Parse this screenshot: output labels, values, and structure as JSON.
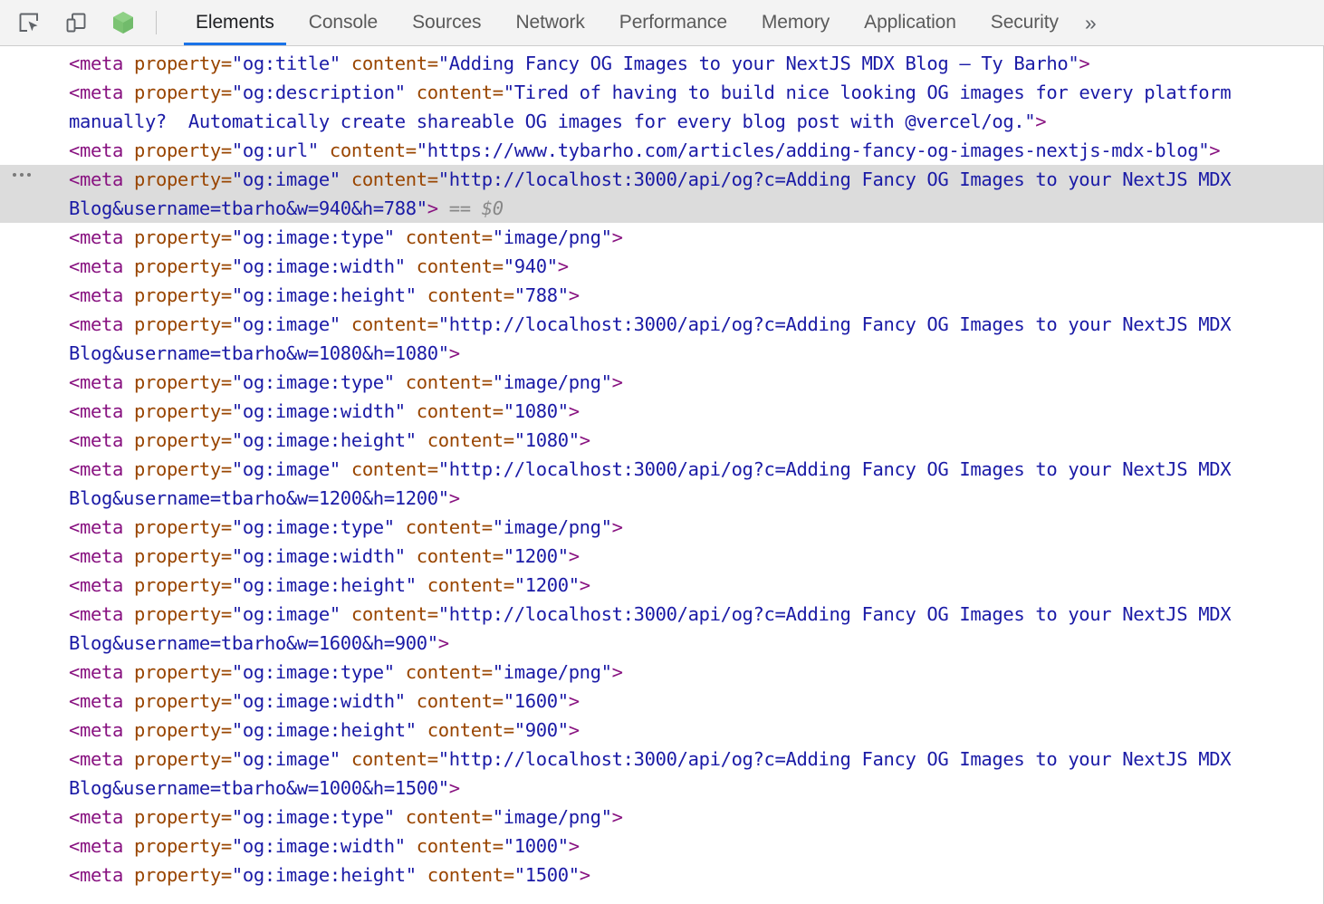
{
  "toolbar": {
    "icons": [
      {
        "name": "inspect-element-icon",
        "title": "Inspect element"
      },
      {
        "name": "device-toolbar-icon",
        "title": "Toggle device toolbar"
      },
      {
        "name": "node-cube-icon",
        "title": "Node.js"
      }
    ],
    "tabs": [
      {
        "label": "Elements",
        "active": true
      },
      {
        "label": "Console",
        "active": false
      },
      {
        "label": "Sources",
        "active": false
      },
      {
        "label": "Network",
        "active": false
      },
      {
        "label": "Performance",
        "active": false
      },
      {
        "label": "Memory",
        "active": false
      },
      {
        "label": "Application",
        "active": false
      },
      {
        "label": "Security",
        "active": false
      }
    ],
    "more_label": "»",
    "active_tab_underline_color": "#1a73e8"
  },
  "colors": {
    "tag": "#881280",
    "attribute_name": "#994500",
    "attribute_value": "#1a1aa6",
    "selected_row_background": "#dcdcdc",
    "toolbar_background": "#f3f3f3",
    "panel_background": "#ffffff",
    "reference_text": "#888888"
  },
  "dom": {
    "selected_node_reference": "== $0",
    "nodes": [
      {
        "id": "node-og-title",
        "tag": "meta",
        "selected": false,
        "attributes": [
          {
            "name": "property",
            "value": "og:title"
          },
          {
            "name": "content",
            "value": "Adding Fancy OG Images to your NextJS MDX Blog – Ty Barho"
          }
        ]
      },
      {
        "id": "node-og-description",
        "tag": "meta",
        "selected": false,
        "attributes": [
          {
            "name": "property",
            "value": "og:description"
          },
          {
            "name": "content",
            "value": "Tired of having to build nice looking OG images for every platform manually?  Automatically create shareable OG images for every blog post with @vercel/og."
          }
        ]
      },
      {
        "id": "node-og-url",
        "tag": "meta",
        "selected": false,
        "attributes": [
          {
            "name": "property",
            "value": "og:url"
          },
          {
            "name": "content",
            "value": "https://www.tybarho.com/articles/adding-fancy-og-images-nextjs-mdx-blog"
          }
        ]
      },
      {
        "id": "node-og-image-940",
        "tag": "meta",
        "selected": true,
        "attributes": [
          {
            "name": "property",
            "value": "og:image"
          },
          {
            "name": "content",
            "value": "http://localhost:3000/api/og?c=Adding Fancy OG Images to your NextJS MDX Blog&username=tbarho&w=940&h=788"
          }
        ]
      },
      {
        "id": "node-og-image-type-1",
        "tag": "meta",
        "selected": false,
        "attributes": [
          {
            "name": "property",
            "value": "og:image:type"
          },
          {
            "name": "content",
            "value": "image/png"
          }
        ]
      },
      {
        "id": "node-og-image-width-940",
        "tag": "meta",
        "selected": false,
        "attributes": [
          {
            "name": "property",
            "value": "og:image:width"
          },
          {
            "name": "content",
            "value": "940"
          }
        ]
      },
      {
        "id": "node-og-image-height-788",
        "tag": "meta",
        "selected": false,
        "attributes": [
          {
            "name": "property",
            "value": "og:image:height"
          },
          {
            "name": "content",
            "value": "788"
          }
        ]
      },
      {
        "id": "node-og-image-1080",
        "tag": "meta",
        "selected": false,
        "attributes": [
          {
            "name": "property",
            "value": "og:image"
          },
          {
            "name": "content",
            "value": "http://localhost:3000/api/og?c=Adding Fancy OG Images to your NextJS MDX Blog&username=tbarho&w=1080&h=1080"
          }
        ]
      },
      {
        "id": "node-og-image-type-2",
        "tag": "meta",
        "selected": false,
        "attributes": [
          {
            "name": "property",
            "value": "og:image:type"
          },
          {
            "name": "content",
            "value": "image/png"
          }
        ]
      },
      {
        "id": "node-og-image-width-1080",
        "tag": "meta",
        "selected": false,
        "attributes": [
          {
            "name": "property",
            "value": "og:image:width"
          },
          {
            "name": "content",
            "value": "1080"
          }
        ]
      },
      {
        "id": "node-og-image-height-1080",
        "tag": "meta",
        "selected": false,
        "attributes": [
          {
            "name": "property",
            "value": "og:image:height"
          },
          {
            "name": "content",
            "value": "1080"
          }
        ]
      },
      {
        "id": "node-og-image-1200",
        "tag": "meta",
        "selected": false,
        "attributes": [
          {
            "name": "property",
            "value": "og:image"
          },
          {
            "name": "content",
            "value": "http://localhost:3000/api/og?c=Adding Fancy OG Images to your NextJS MDX Blog&username=tbarho&w=1200&h=1200"
          }
        ]
      },
      {
        "id": "node-og-image-type-3",
        "tag": "meta",
        "selected": false,
        "attributes": [
          {
            "name": "property",
            "value": "og:image:type"
          },
          {
            "name": "content",
            "value": "image/png"
          }
        ]
      },
      {
        "id": "node-og-image-width-1200",
        "tag": "meta",
        "selected": false,
        "attributes": [
          {
            "name": "property",
            "value": "og:image:width"
          },
          {
            "name": "content",
            "value": "1200"
          }
        ]
      },
      {
        "id": "node-og-image-height-1200",
        "tag": "meta",
        "selected": false,
        "attributes": [
          {
            "name": "property",
            "value": "og:image:height"
          },
          {
            "name": "content",
            "value": "1200"
          }
        ]
      },
      {
        "id": "node-og-image-1600",
        "tag": "meta",
        "selected": false,
        "attributes": [
          {
            "name": "property",
            "value": "og:image"
          },
          {
            "name": "content",
            "value": "http://localhost:3000/api/og?c=Adding Fancy OG Images to your NextJS MDX Blog&username=tbarho&w=1600&h=900"
          }
        ]
      },
      {
        "id": "node-og-image-type-4",
        "tag": "meta",
        "selected": false,
        "attributes": [
          {
            "name": "property",
            "value": "og:image:type"
          },
          {
            "name": "content",
            "value": "image/png"
          }
        ]
      },
      {
        "id": "node-og-image-width-1600",
        "tag": "meta",
        "selected": false,
        "attributes": [
          {
            "name": "property",
            "value": "og:image:width"
          },
          {
            "name": "content",
            "value": "1600"
          }
        ]
      },
      {
        "id": "node-og-image-height-900",
        "tag": "meta",
        "selected": false,
        "attributes": [
          {
            "name": "property",
            "value": "og:image:height"
          },
          {
            "name": "content",
            "value": "900"
          }
        ]
      },
      {
        "id": "node-og-image-1000",
        "tag": "meta",
        "selected": false,
        "attributes": [
          {
            "name": "property",
            "value": "og:image"
          },
          {
            "name": "content",
            "value": "http://localhost:3000/api/og?c=Adding Fancy OG Images to your NextJS MDX Blog&username=tbarho&w=1000&h=1500"
          }
        ]
      },
      {
        "id": "node-og-image-type-5",
        "tag": "meta",
        "selected": false,
        "attributes": [
          {
            "name": "property",
            "value": "og:image:type"
          },
          {
            "name": "content",
            "value": "image/png"
          }
        ]
      },
      {
        "id": "node-og-image-width-1000",
        "tag": "meta",
        "selected": false,
        "attributes": [
          {
            "name": "property",
            "value": "og:image:width"
          },
          {
            "name": "content",
            "value": "1000"
          }
        ]
      },
      {
        "id": "node-og-image-height-1500",
        "tag": "meta",
        "selected": false,
        "attributes": [
          {
            "name": "property",
            "value": "og:image:height"
          },
          {
            "name": "content",
            "value": "1500"
          }
        ]
      }
    ]
  }
}
